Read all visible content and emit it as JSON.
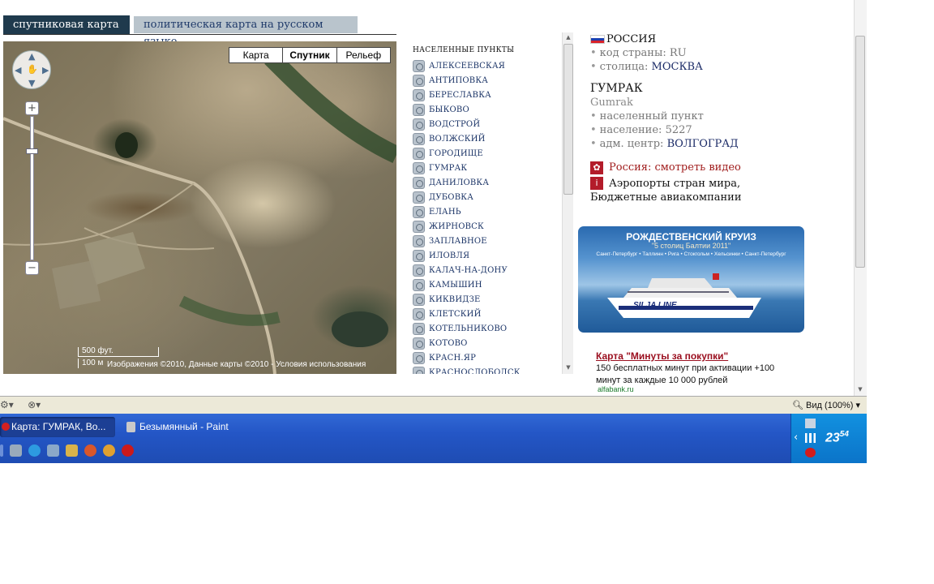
{
  "tabs": {
    "satellite": "спутниковая карта",
    "political": "политическая карта на русском языке"
  },
  "map": {
    "types": [
      "Карта",
      "Спутник",
      "Рельеф"
    ],
    "active_type": "Спутник",
    "scale_top": "500 фут.",
    "scale_bottom": "100 м",
    "copyright": "Изображения ©2010, Данные карты ©2010 - Условия использования",
    "zoom_in": "+",
    "zoom_out": "−"
  },
  "settlements": {
    "header": "НАСЕЛЕННЫЕ ПУНКТЫ",
    "items": [
      "АЛЕКСЕЕВСКАЯ",
      "АНТИПОВКА",
      "БЕРЕСЛАВКА",
      "БЫКОВО",
      "ВОДСТРОЙ",
      "ВОЛЖСКИЙ",
      "ГОРОДИЩЕ",
      "ГУМРАК",
      "ДАНИЛОВКА",
      "ДУБОВКА",
      "ЕЛАНЬ",
      "ЖИРНОВСК",
      "ЗАПЛАВНОЕ",
      "ИЛОВЛЯ",
      "КАЛАЧ-НА-ДОНУ",
      "КАМЫШИН",
      "КИКВИДЗЕ",
      "КЛЕТСКИЙ",
      "КОТЕЛЬНИКОВО",
      "КОТОВО",
      "КРАСН.ЯР",
      "КРАСНОСЛОБОДСК"
    ]
  },
  "info": {
    "country": "РОССИЯ",
    "country_code_label": "код страны:",
    "country_code": "RU",
    "capital_label": "столица:",
    "capital": "МОСКВА",
    "place": "ГУМРАК",
    "place_latin": "Gumrak",
    "place_type": "населенный пункт",
    "population_label": "население:",
    "population": "5227",
    "adm_center_label": "адм. центр:",
    "adm_center": "ВОЛГОГРАД",
    "video_link": "Россия: смотреть видео",
    "links_line1": "Аэропорты стран мира,",
    "links_line2": "Бюджетные авиакомпании"
  },
  "banner": {
    "title": "РОЖДЕСТВЕНСКИЙ КРУИЗ",
    "subtitle": "\"5 столиц Балтии 2011\"",
    "route": "Санкт-Петербург • Таллинн • Рига • Стокгольм • Хельсинки • Санкт-Петербург",
    "ship_name": "SILJA LINE"
  },
  "promo": {
    "title": "Карта \"Минуты за покупки\"",
    "body": "150 бесплатных минут при активации +100 минут за каждые 10 000 рублей",
    "link": "alfabank.ru"
  },
  "statusbar": {
    "zoom": "Вид (100%)"
  },
  "taskbar": {
    "active_task": "Карта: ГУМРАК, Во...",
    "inactive_task": "Безымянный - Paint",
    "clock_hour": "23",
    "clock_min": "54"
  },
  "colors": {
    "tab_active": "#1f3a4d",
    "link_red": "#a01c1c",
    "taskbar": "#2456c6"
  }
}
